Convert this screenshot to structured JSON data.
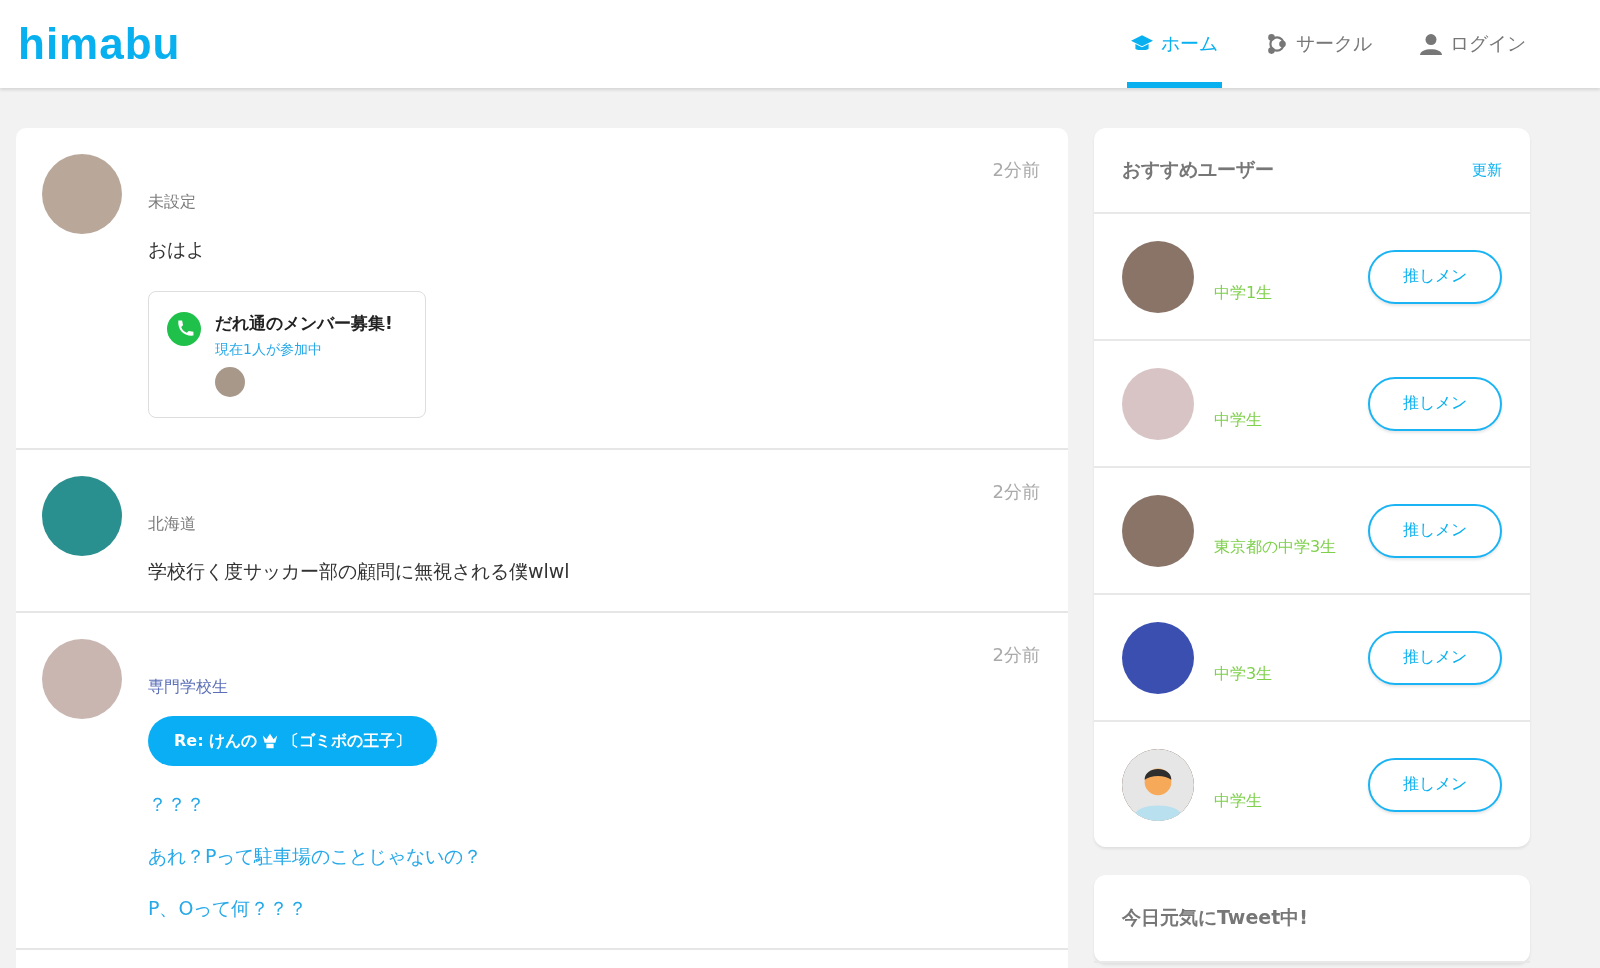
{
  "header": {
    "logo": "himabu",
    "nav": [
      {
        "label": "ホーム",
        "kind": "cap",
        "selected": true
      },
      {
        "label": "サークル",
        "kind": "circle",
        "selected": false
      },
      {
        "label": "ログイン",
        "kind": "user",
        "selected": false
      }
    ]
  },
  "posts": [
    {
      "author": "未設定",
      "color": "#7a7a7a",
      "time": "2分前",
      "lines": [
        "おはよ"
      ],
      "kind": "text",
      "call": {
        "title": "だれ通のメンバー募集!",
        "status": "現在1人が参加中"
      }
    },
    {
      "author": "北海道",
      "color": "#7a7a7a",
      "time": "2分前",
      "lines": [
        "学校行く度サッカー部の顧問に無視される僕wlwl"
      ],
      "kind": "text"
    },
    {
      "author": "専門学校生",
      "color": "#5b6fb8",
      "time": "2分前",
      "reply": {
        "before": "Re: けんの",
        "after": "〔ゴミボの王子〕"
      },
      "lines": [
        "？？？",
        "あれ？Pって駐車場のことじゃないの？",
        "P、Oって何？？？"
      ],
      "kind": "link"
    }
  ],
  "recommend": {
    "title": "おすすめユーザー",
    "refresh": "更新",
    "users": [
      {
        "label": "中学1生",
        "kind": "photo",
        "button": "推しメン"
      },
      {
        "label": "中学生",
        "kind": "photo",
        "button": "推しメン"
      },
      {
        "label": "東京都の中学3生",
        "kind": "photo",
        "button": "推しメン"
      },
      {
        "label": "中学3生",
        "kind": "photo",
        "button": "推しメン"
      },
      {
        "label": "中学生",
        "kind": "default",
        "button": "推しメン"
      }
    ]
  },
  "tweeting": {
    "title": "今日元気にTweet中!"
  }
}
